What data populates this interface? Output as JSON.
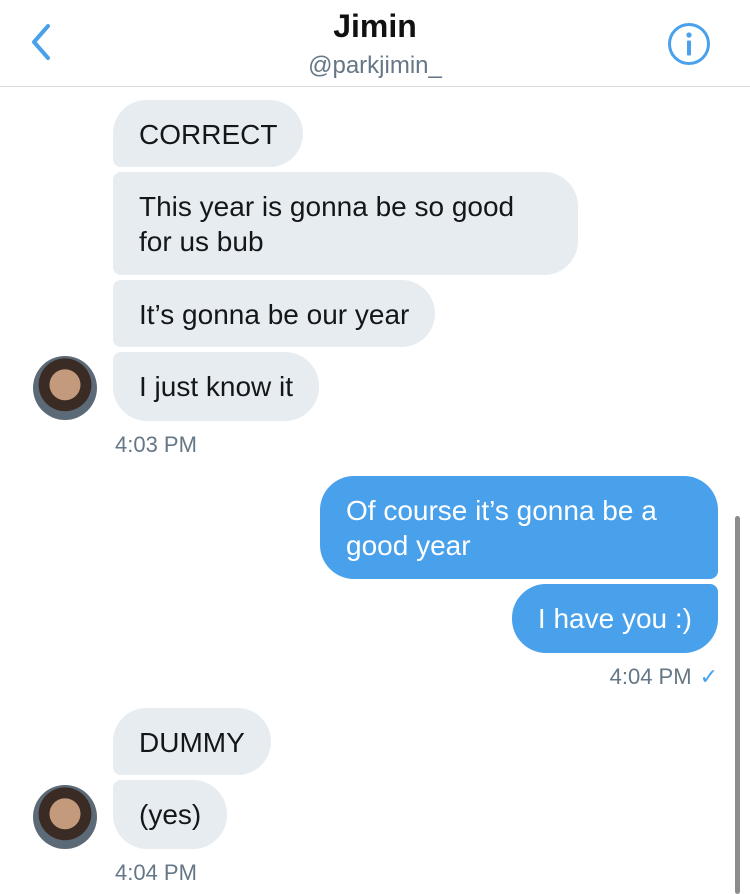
{
  "header": {
    "name": "Jimin",
    "handle": "@parkjimin_"
  },
  "icons": {
    "back": "chevron-left-icon",
    "info": "info-circle-icon",
    "accent": "#4aa1eb"
  },
  "messages": [
    {
      "direction": "incoming",
      "text": "CORRECT"
    },
    {
      "direction": "incoming",
      "text": "This year is gonna be so good for us bub"
    },
    {
      "direction": "incoming",
      "text": "It’s gonna be our year"
    },
    {
      "direction": "incoming",
      "text": "I just know it"
    },
    {
      "direction": "outgoing",
      "text": "Of course it’s gonna be a good year"
    },
    {
      "direction": "outgoing",
      "text": "I have you :)"
    },
    {
      "direction": "incoming",
      "text": "DUMMY"
    },
    {
      "direction": "incoming",
      "text": "(yes)"
    }
  ],
  "timestamps": [
    "4:03 PM",
    "4:04 PM",
    "4:04 PM"
  ],
  "read_check": "✓"
}
